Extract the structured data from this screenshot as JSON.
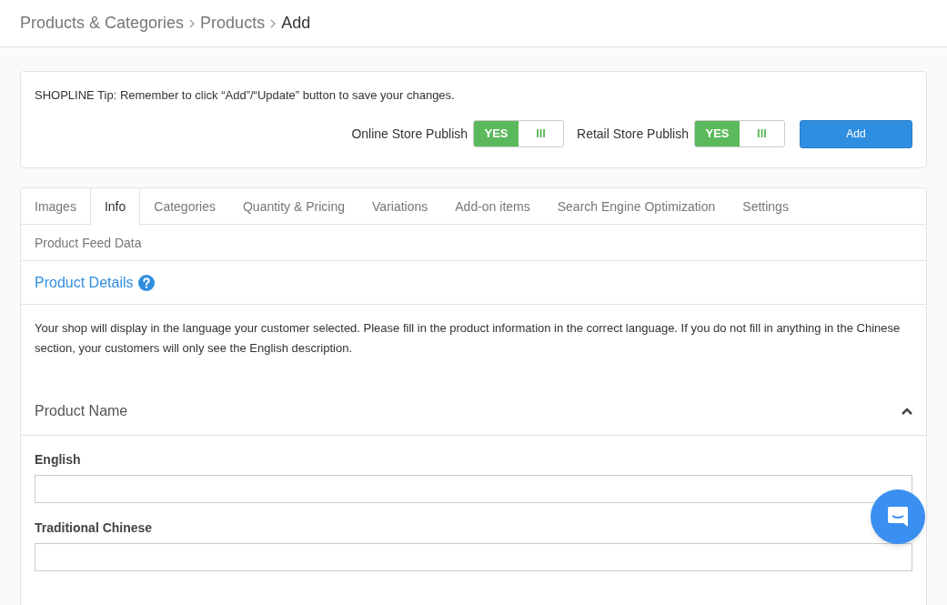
{
  "breadcrumb": [
    {
      "label": "Products & Categories",
      "current": false
    },
    {
      "label": "Products",
      "current": false
    },
    {
      "label": "Add",
      "current": true
    }
  ],
  "tip": "SHOPLINE Tip: Remember to click “Add”/“Update” button to save your changes.",
  "publish_toggles": [
    {
      "label": "Online Store Publish",
      "on": true,
      "on_text": "YES",
      "off_text": "III"
    },
    {
      "label": "Retail Store Publish",
      "on": true,
      "on_text": "YES",
      "off_text": "III"
    }
  ],
  "add_button": "Add",
  "tabs": [
    {
      "label": "Images",
      "selected": false
    },
    {
      "label": "Info",
      "selected": true
    },
    {
      "label": "Categories",
      "selected": false
    },
    {
      "label": "Quantity & Pricing",
      "selected": false
    },
    {
      "label": "Variations",
      "selected": false
    },
    {
      "label": "Add-on items",
      "selected": false
    },
    {
      "label": "Search Engine Optimization",
      "selected": false
    },
    {
      "label": "Settings",
      "selected": false
    },
    {
      "label": "Product Feed Data",
      "selected": false
    }
  ],
  "section_title": "Product Details",
  "description": "Your shop will display in the language your customer selected. Please fill in the product information in the correct language. If you do not fill in anything in the Chinese section, your customers will only see the English description.",
  "product_name": {
    "title": "Product Name",
    "expanded": true,
    "fields": [
      {
        "label": "English"
      },
      {
        "label": "Traditional Chinese"
      }
    ]
  }
}
